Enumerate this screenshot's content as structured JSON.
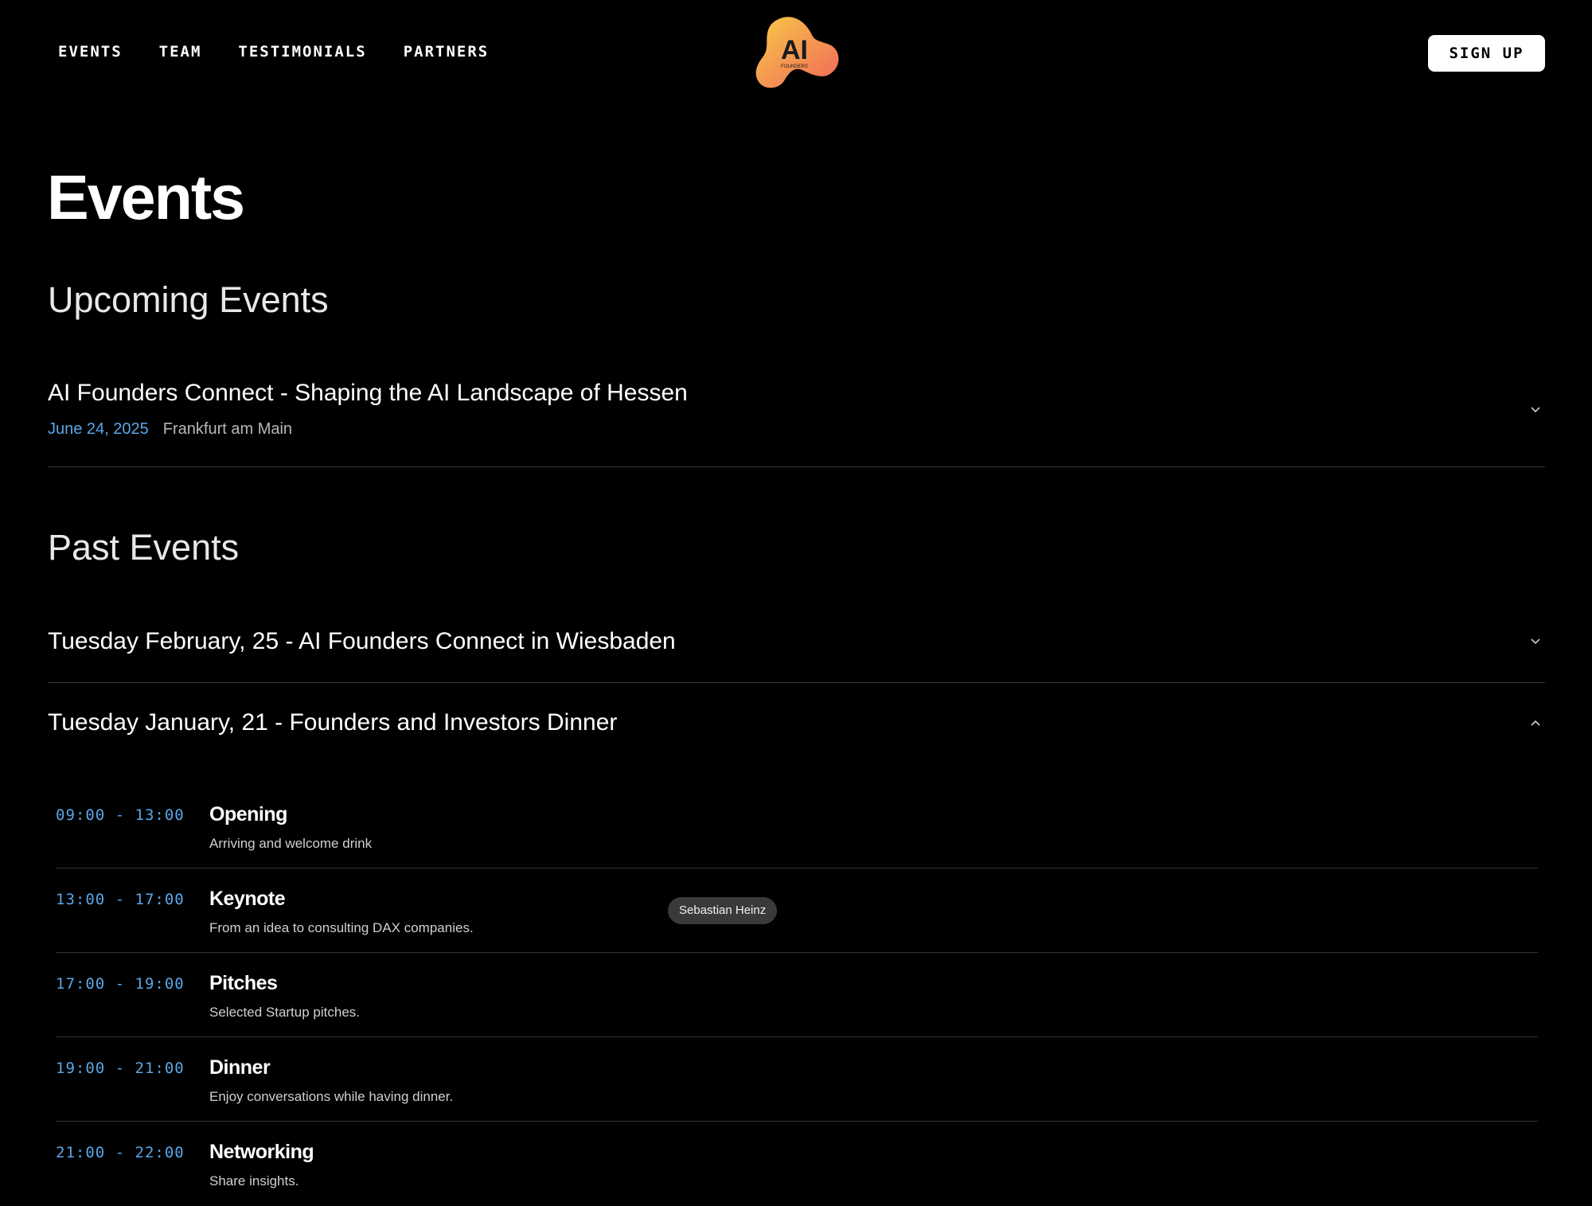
{
  "header": {
    "nav": [
      "EVENTS",
      "TEAM",
      "TESTIMONIALS",
      "PARTNERS"
    ],
    "logo_text": "AI",
    "logo_subtext": "FOUNDERS",
    "signup_label": "SIGN UP"
  },
  "main": {
    "page_title": "Events",
    "upcoming_title": "Upcoming Events",
    "upcoming": [
      {
        "title": "AI Founders Connect - Shaping the AI Landscape of Hessen",
        "date": "June 24, 2025",
        "location": "Frankfurt am Main",
        "expanded": false
      }
    ],
    "past_title": "Past Events",
    "past": [
      {
        "title": "Tuesday February, 25 - AI Founders Connect in Wiesbaden",
        "expanded": false
      },
      {
        "title": "Tuesday January, 21 - Founders and Investors Dinner",
        "expanded": true
      }
    ],
    "schedule": [
      {
        "time": "09:00 - 13:00",
        "title": "Opening",
        "description": "Arriving and welcome drink"
      },
      {
        "time": "13:00 - 17:00",
        "title": "Keynote",
        "description": "From an idea to consulting DAX companies.",
        "speaker": "Sebastian Heinz"
      },
      {
        "time": "17:00 - 19:00",
        "title": "Pitches",
        "description": "Selected Startup pitches."
      },
      {
        "time": "19:00 - 21:00",
        "title": "Dinner",
        "description": "Enjoy conversations while having dinner."
      },
      {
        "time": "21:00 - 22:00",
        "title": "Networking",
        "description": "Share insights."
      }
    ]
  },
  "colors": {
    "background": "#000000",
    "accent_blue": "#5aa6e8",
    "logo_gradient_start": "#f7c948",
    "logo_gradient_end": "#f2675a"
  },
  "icons": [
    "chevron-down-icon",
    "chevron-up-icon"
  ]
}
